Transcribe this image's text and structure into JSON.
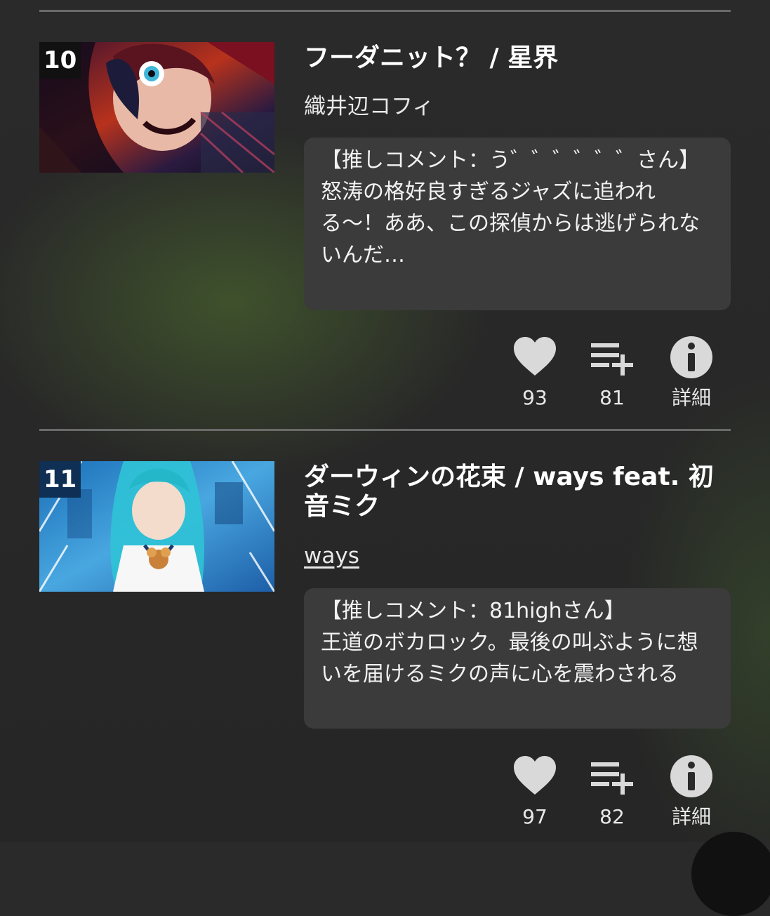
{
  "entries": [
    {
      "rank": "10",
      "title": "フーダニット？ / 星界",
      "artist": "織井辺コフィ",
      "comment_header": "【推しコメント：う゛゛゛゛゛゛さん】",
      "comment_body": "怒涛の格好良すぎるジャズに追われる〜！ああ、この探偵からは逃げられないんだ…",
      "likes": "93",
      "playlist_adds": "81",
      "details_label": "詳細"
    },
    {
      "rank": "11",
      "title": "ダーウィンの花束 / ways feat. 初音ミク",
      "artist": "ways",
      "comment_header": "【推しコメント：81highさん】",
      "comment_body": "王道のボカロック。最後の叫ぶように想いを届けるミクの声に心を震わされる",
      "likes": "97",
      "playlist_adds": "82",
      "details_label": "詳細"
    }
  ],
  "icons": {
    "like": "heart-icon",
    "playlist": "playlist-add-icon",
    "details": "info-icon"
  },
  "colors": {
    "icon": "#d9d9d9",
    "comment_bg": "#3b3b3b",
    "divider": "#6a6a6a"
  }
}
